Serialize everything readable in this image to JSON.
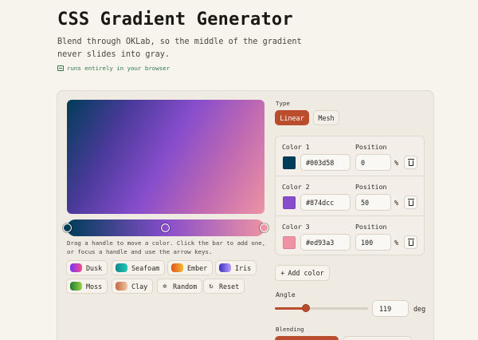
{
  "header": {
    "title": "CSS Gradient Generator",
    "subtitle": "Blend through OKLab, so the middle of the gradient never slides into gray.",
    "note": "runs entirely in your browser"
  },
  "preview": {
    "angle": 119,
    "hint": "Drag a handle to move a color. Click the bar to add one, or focus a handle and use the arrow keys."
  },
  "presets": [
    {
      "label": "Dusk",
      "from": "#7b2ff7",
      "to": "#f64f8b"
    },
    {
      "label": "Seafoam",
      "from": "#0b8a8f",
      "to": "#27c6b8"
    },
    {
      "label": "Ember",
      "from": "#e2531b",
      "to": "#f7b733"
    },
    {
      "label": "Iris",
      "from": "#3b2fbf",
      "to": "#b89cff"
    },
    {
      "label": "Moss",
      "from": "#1f7a2e",
      "to": "#9bd34c"
    },
    {
      "label": "Clay",
      "from": "#c4673f",
      "to": "#f0c7a8"
    }
  ],
  "actions": {
    "random": "Random",
    "reset": "Reset"
  },
  "type": {
    "label": "Type",
    "options": [
      "Linear",
      "Mesh"
    ],
    "selected": "Linear"
  },
  "colors": [
    {
      "label": "Color 1",
      "hex": "#003d58",
      "position": "0"
    },
    {
      "label": "Color 2",
      "hex": "#874dcc",
      "position": "50"
    },
    {
      "label": "Color 3",
      "hex": "#ed93a3",
      "position": "100"
    }
  ],
  "position_label": "Position",
  "percent": "%",
  "add_color": "Add color",
  "angle": {
    "label": "Angle",
    "value": "119",
    "unit": "deg",
    "min": 0,
    "max": 360
  },
  "blending": {
    "label": "Blending"
  },
  "colors_theme": {
    "accent": "#b94d2e",
    "success": "#2f7a4d"
  }
}
